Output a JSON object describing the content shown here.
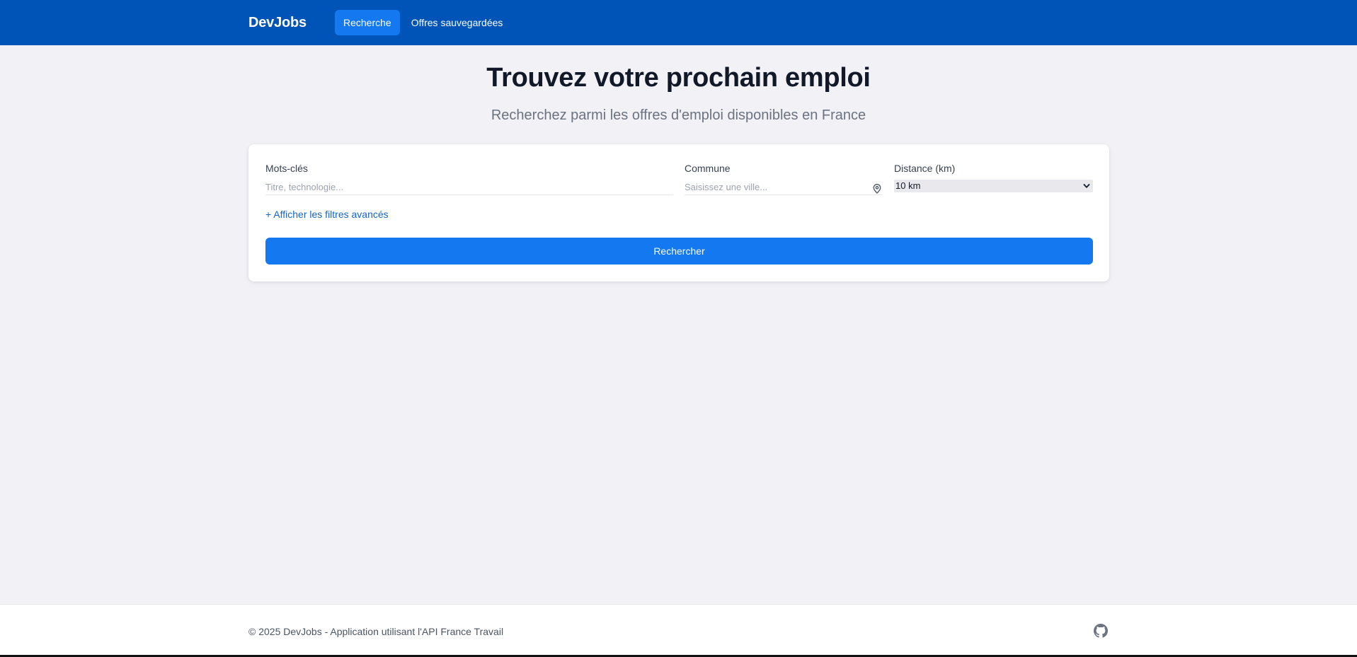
{
  "nav": {
    "brand": "DevJobs",
    "links": [
      {
        "label": "Recherche",
        "active": true
      },
      {
        "label": "Offres sauvegardées",
        "active": false
      }
    ]
  },
  "hero": {
    "title": "Trouvez votre prochain emploi",
    "subtitle": "Recherchez parmi les offres d'emploi disponibles en France"
  },
  "search": {
    "keywords": {
      "label": "Mots-clés",
      "value": "",
      "placeholder": "Titre, technologie..."
    },
    "commune": {
      "label": "Commune",
      "value": "",
      "placeholder": "Saisissez une ville...",
      "icon": "location-pin-icon"
    },
    "distance": {
      "label": "Distance (km)",
      "selected": "10 km"
    },
    "advanced_filters_label": "+ Afficher les filtres avancés",
    "submit_label": "Rechercher"
  },
  "footer": {
    "copyright": "© 2025 DevJobs - Application utilisant l'API France Travail",
    "icon": "github-icon"
  },
  "colors": {
    "navbar": "#0054b8",
    "accent": "#1478f0",
    "link": "#1565c0",
    "background": "#f1f1f6"
  }
}
